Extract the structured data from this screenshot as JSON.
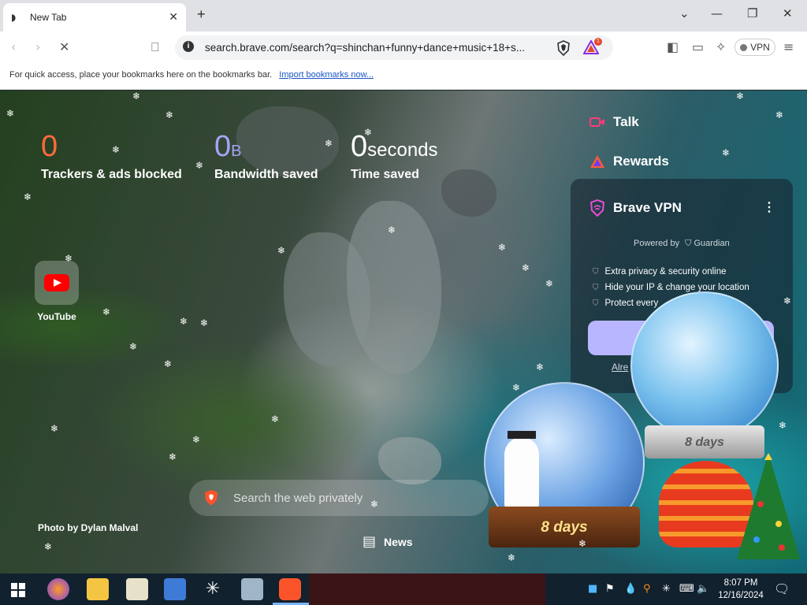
{
  "browser": {
    "tab": {
      "title": "New Tab"
    },
    "omnibox": {
      "url": "search.brave.com/search?q=shinchan+funny+dance+music+18+s..."
    },
    "vpn_button": "VPN",
    "rewards_badge": "1"
  },
  "bookmarks_bar": {
    "message": "For quick access, place your bookmarks here on the bookmarks bar.",
    "import_link": "Import bookmarks now..."
  },
  "ntp": {
    "stats": [
      {
        "value": "0",
        "unit": "",
        "label": "Trackers & ads blocked",
        "color": "#ff6a3d"
      },
      {
        "value": "0",
        "unit": "B",
        "label": "Bandwidth saved",
        "color": "#a6a4f8"
      },
      {
        "value": "0",
        "unit": "seconds",
        "label": "Time saved",
        "color": "#ffffff"
      }
    ],
    "top_sites": [
      {
        "label": "YouTube",
        "icon": "youtube-icon"
      }
    ],
    "photo_credit": "Photo by Dylan Malval",
    "search_placeholder": "Search the web privately",
    "news_label": "News",
    "widgets": {
      "talk": "Talk",
      "rewards": "Rewards",
      "vpn": {
        "title": "Brave VPN",
        "powered_by": "Powered by",
        "partner": "Guardian",
        "features": [
          "Extra privacy & security online",
          "Hide your IP & change your location",
          "Protect every"
        ],
        "already_link": "Alre"
      }
    },
    "globes": [
      {
        "days": "8 days"
      },
      {
        "days": "8 days"
      }
    ]
  },
  "taskbar": {
    "time": "8:07 PM",
    "date": "12/16/2024"
  },
  "colors": {
    "accent": "#b8b6ff",
    "brave_orange": "#fb542b",
    "taskbar": "#11212e"
  }
}
